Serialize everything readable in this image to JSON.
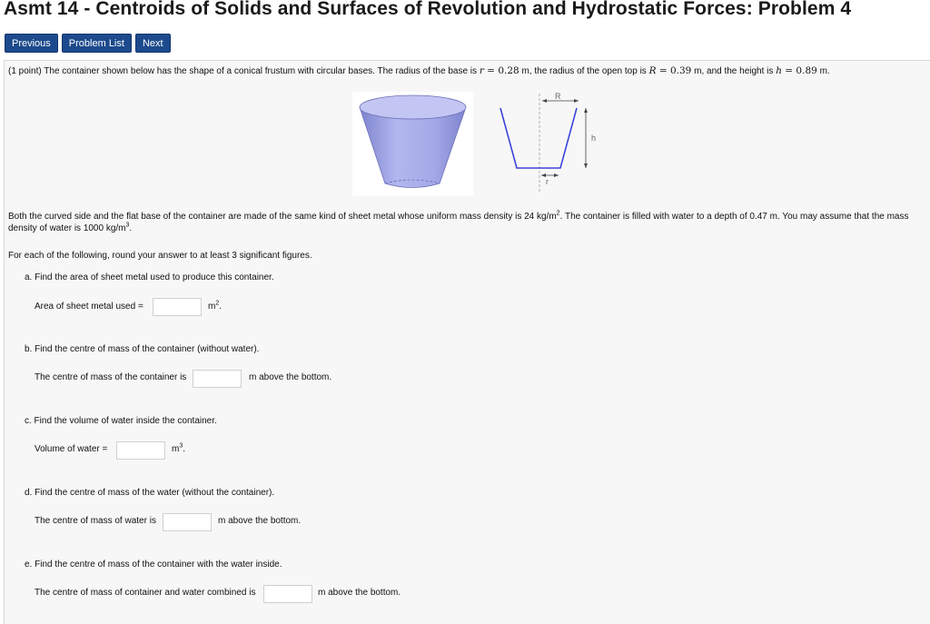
{
  "title": "Asmt 14 - Centroids of Solids and Surfaces of Revolution and Hydrostatic Forces: Problem 4",
  "nav": {
    "previous": "Previous",
    "problem_list": "Problem List",
    "next": "Next"
  },
  "intro": {
    "prefix": "(1 point) The container shown below has the shape of a conical frustum with circular bases. The radius of the base is ",
    "r_sym": "r",
    "r_val": " = 0.28",
    "mid1": " m, the radius of the open top is ",
    "R_sym": "R",
    "R_val": " = 0.39",
    "mid2": " m, and the height is ",
    "h_sym": "h",
    "h_val": " = 0.89",
    "suffix": " m."
  },
  "diagram": {
    "R": "R",
    "h": "h",
    "r": "r"
  },
  "description": {
    "line1a": "Both the curved side and the flat base of the container are made of the same kind of sheet metal whose uniform mass density is 24 kg/m",
    "line1_exp": "2",
    "line1b": ". The container is filled with water to a depth of 0.47 m. You may assume that the mass",
    "line2a": "density of water is 1000 kg/m",
    "line2_exp": "3",
    "line2b": "."
  },
  "instruction": "For each of the following, round your answer to at least 3 significant figures.",
  "parts": {
    "a": {
      "q": "a. Find the area of sheet metal used to produce this container.",
      "label": "Area of sheet metal used =",
      "unit": "m",
      "unit_exp": "2",
      "unit_end": ".",
      "value": ""
    },
    "b": {
      "q": "b. Find the centre of mass of the container (without water).",
      "label": "The centre of mass of the container is",
      "unit": "m above the bottom.",
      "value": ""
    },
    "c": {
      "q": "c. Find the volume of water inside the container.",
      "label": "Volume of water =",
      "unit": "m",
      "unit_exp": "3",
      "unit_end": ".",
      "value": ""
    },
    "d": {
      "q": "d. Find the centre of mass of the water (without the container).",
      "label": "The centre of mass of water is",
      "unit": "m above the bottom.",
      "value": ""
    },
    "e": {
      "q": "e. Find the centre of mass of the container with the water inside.",
      "label": "The centre of mass of container and water combined is",
      "unit": "m above the bottom.",
      "value": ""
    }
  },
  "colors": {
    "button_bg": "#1c4a8c",
    "frustum": "#9a9fe0",
    "diagram_line": "#3a44d8"
  }
}
